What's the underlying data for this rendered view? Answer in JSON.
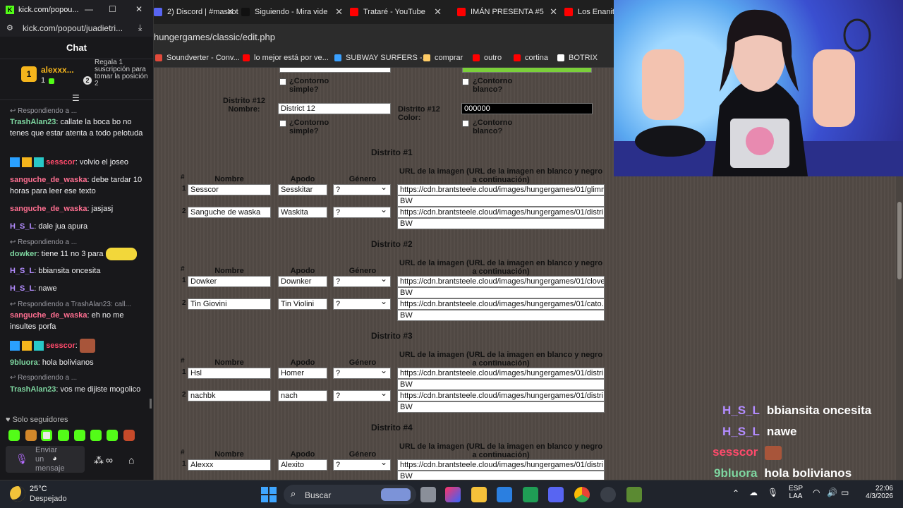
{
  "chat_window": {
    "title": "kick.com/popou...",
    "url": "kick.com/popout/juadietri...",
    "header": "Chat",
    "leader": {
      "rank": "1",
      "name": "alexxx...",
      "count": "1",
      "gift_rank": "2",
      "gift_text": "Regala 1 suscripción para tomar la posición 2"
    },
    "messages": [
      {
        "reply": "Respondiendo a ...",
        "user": "TrashAlan23",
        "color": "#7ed6a0",
        "text": "callate la boca bo no tenes que estar atenta a todo pelotuda"
      },
      {
        "user": "sesscor",
        "color": "#ff4a6b",
        "text": "volvio el joseo"
      },
      {
        "user": "sanguche_de_waska",
        "color": "#ff6f91",
        "text": "debe tardar 10 horas para leer ese texto"
      },
      {
        "user": "sanguche_de_waska",
        "color": "#ff6f91",
        "text": "jasjasj"
      },
      {
        "user": "H_S_L",
        "color": "#b38cff",
        "text": "dale jua apura"
      },
      {
        "reply": "Respondiendo a ...",
        "user": "dowker",
        "color": "#7ed6a0",
        "text": "tiene 11 no 3 para"
      },
      {
        "user": "H_S_L",
        "color": "#b38cff",
        "text": "bbiansita oncesita"
      },
      {
        "user": "H_S_L",
        "color": "#b38cff",
        "text": "nawe"
      },
      {
        "reply": "Respondiendo a TrashAlan23: call...",
        "user": "sanguche_de_waska",
        "color": "#ff6f91",
        "text": "eh no me insultes porfa"
      },
      {
        "user": "sesscor",
        "color": "#ff4a6b",
        "text": ""
      },
      {
        "user": "9bluora",
        "color": "#7ed6a0",
        "text": "hola bolivianos"
      },
      {
        "reply": "Respondiendo a ...",
        "user": "TrashAlan23",
        "color": "#7ed6a0",
        "text": "vos me dijiste mogolico"
      }
    ],
    "followers_only": "Solo seguidores",
    "input_placeholder": "Enviar un mensaje"
  },
  "browser": {
    "tabs": [
      {
        "label": "2) Discord | #mascot",
        "color": "#5865f2"
      },
      {
        "label": "Siguiendo - Mira vide",
        "color": "#111111"
      },
      {
        "label": "Trataré - YouTube",
        "color": "#ff0000"
      },
      {
        "label": "IMÁN PRESENTA #5",
        "color": "#ff0000"
      },
      {
        "label": "Los Enanito",
        "color": "#ff0000"
      }
    ],
    "address": "hungergames/classic/edit.php",
    "bookmarks": [
      {
        "label": "Soundverter - Conv...",
        "color": "#e24a3b"
      },
      {
        "label": "lo mejor está por ve...",
        "color": "#ff0000"
      },
      {
        "label": "SUBWAY SURFERS -...",
        "color": "#3aa0ff"
      },
      {
        "label": "comprar",
        "color": "#ffcc66"
      },
      {
        "label": "outro",
        "color": "#ff0000"
      },
      {
        "label": "cortina",
        "color": "#ff0000"
      },
      {
        "label": "BOTRIX",
        "color": "#ffffff"
      }
    ]
  },
  "editor": {
    "contorno_simple": "¿Contorno simple?",
    "contorno_blanco": "¿Contorno blanco?",
    "district12": {
      "name_label": "Distrito #12 Nombre:",
      "name_value": "District 12",
      "color_label": "Distrito #12 Color:",
      "color_value": "000000"
    },
    "headers": {
      "num": "#",
      "nombre": "Nombre",
      "apodo": "Apodo",
      "genero": "Género",
      "url": "URL de la imagen (URL de la imagen en blanco y negro a continuación)"
    },
    "districts": [
      {
        "title": "Distrito #1",
        "rows": [
          {
            "num": "1",
            "nombre": "Sesscor",
            "apodo": "Sesskitar",
            "genero": "?",
            "url": "https://cdn.brantsteele.cloud/images/hungergames/01/glimm",
            "bw": "BW"
          },
          {
            "num": "2",
            "nombre": "Sanguche de waska",
            "apodo": "Waskita",
            "genero": "?",
            "url": "https://cdn.brantsteele.cloud/images/hungergames/01/distri",
            "bw": "BW"
          }
        ]
      },
      {
        "title": "Distrito #2",
        "rows": [
          {
            "num": "1",
            "nombre": "Dowker",
            "apodo": "Downker",
            "genero": "?",
            "url": "https://cdn.brantsteele.cloud/images/hungergames/01/clove",
            "bw": "BW"
          },
          {
            "num": "2",
            "nombre": "Tin Giovini",
            "apodo": "Tin Violini",
            "genero": "?",
            "url": "https://cdn.brantsteele.cloud/images/hungergames/01/cato.",
            "bw": "BW"
          }
        ]
      },
      {
        "title": "Distrito #3",
        "rows": [
          {
            "num": "1",
            "nombre": "Hsl",
            "apodo": "Homer",
            "genero": "?",
            "url": "https://cdn.brantsteele.cloud/images/hungergames/01/distri",
            "bw": "BW"
          },
          {
            "num": "2",
            "nombre": "nachbk",
            "apodo": "nach",
            "genero": "?",
            "url": "https://cdn.brantsteele.cloud/images/hungergames/01/distri",
            "bw": "BW"
          }
        ]
      },
      {
        "title": "Distrito #4",
        "rows": [
          {
            "num": "1",
            "nombre": "Alexxx",
            "apodo": "Alexito",
            "genero": "?",
            "url": "https://cdn.brantsteele.cloud/images/hungergames/01/distri",
            "bw": "BW"
          }
        ]
      }
    ]
  },
  "stream_overlay": [
    {
      "user": "H_S_L",
      "color": "#b38cff",
      "text": "bbiansita oncesita"
    },
    {
      "user": "H_S_L",
      "color": "#b38cff",
      "text": "nawe"
    },
    {
      "user": "sesscor",
      "color": "#ff4a6b",
      "text": ""
    },
    {
      "user": "9bluora",
      "color": "#7ed6a0",
      "text": "hola bolivianos"
    }
  ],
  "taskbar": {
    "weather_temp": "25°C",
    "weather_desc": "Despejado",
    "search_label": "Buscar",
    "lang_top": "ESP",
    "lang_bottom": "LAA",
    "time": "22:06",
    "date": "4/3/2026"
  }
}
